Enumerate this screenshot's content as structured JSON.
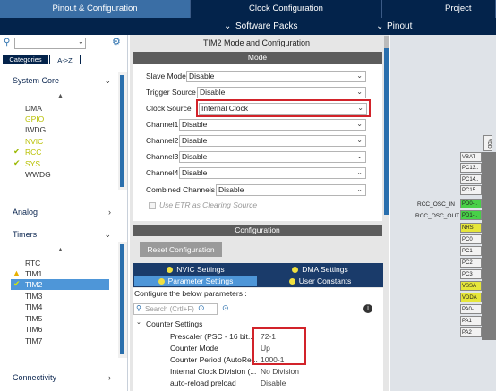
{
  "tabs": {
    "pinout_config": "Pinout & Configuration",
    "clock_config": "Clock Configuration",
    "project_manager": "Project Manag"
  },
  "subtabs": {
    "software_packs": "Software Packs",
    "pinout": "Pinout"
  },
  "sidebar": {
    "filter_tabs": {
      "categories": "Categories",
      "az": "A->Z"
    },
    "system_core": {
      "title": "System Core",
      "items": [
        "DMA",
        "GPIO",
        "IWDG",
        "NVIC",
        "RCC",
        "SYS",
        "WWDG"
      ]
    },
    "analog": {
      "title": "Analog"
    },
    "timers": {
      "title": "Timers",
      "items": [
        "RTC",
        "TIM1",
        "TIM2",
        "TIM3",
        "TIM4",
        "TIM5",
        "TIM6",
        "TIM7"
      ]
    },
    "connectivity": {
      "title": "Connectivity"
    }
  },
  "panel": {
    "title": "TIM2 Mode and Configuration",
    "mode_header": "Mode",
    "mode_fields": [
      {
        "label": "Slave Mode",
        "value": "Disable"
      },
      {
        "label": "Trigger Source",
        "value": "Disable"
      },
      {
        "label": "Clock Source",
        "value": "Internal Clock"
      },
      {
        "label": "Channel1",
        "value": "Disable"
      },
      {
        "label": "Channel2",
        "value": "Disable"
      },
      {
        "label": "Channel3",
        "value": "Disable"
      },
      {
        "label": "Channel4",
        "value": "Disable"
      },
      {
        "label": "Combined Channels",
        "value": "Disable"
      }
    ],
    "use_etr": "Use ETR as Clearing Source",
    "config_header": "Configuration",
    "reset_button": "Reset Configuration",
    "settings_tabs": [
      "NVIC Settings",
      "DMA Settings",
      "Parameter Settings",
      "User Constants"
    ],
    "configure_hint": "Configure the below parameters :",
    "search_placeholder": "Search (Crtl+F)",
    "counter_settings": "Counter Settings",
    "params": [
      {
        "label": "Prescaler (PSC - 16 bit...",
        "value": "72-1"
      },
      {
        "label": "Counter Mode",
        "value": "Up"
      },
      {
        "label": "Counter Period (AutoRe...",
        "value": "1000-1"
      },
      {
        "label": "Internal Clock Division (...",
        "value": "No Division"
      },
      {
        "label": "auto-reload preload",
        "value": "Disable"
      }
    ]
  },
  "pinout": {
    "pins": [
      "VBAT",
      "PC13..",
      "PC14..",
      "PC15..",
      "PD0-..",
      "PD1-..",
      "NRST",
      "PC0",
      "PC1",
      "PC2",
      "PC3",
      "VSSA",
      "VDDA",
      "PA0-..",
      "PA1",
      "PA2"
    ],
    "labels": {
      "osc_in": "RCC_OSC_IN",
      "osc_out": "RCC_OSC_OUT"
    },
    "top_pin": "VDD"
  }
}
